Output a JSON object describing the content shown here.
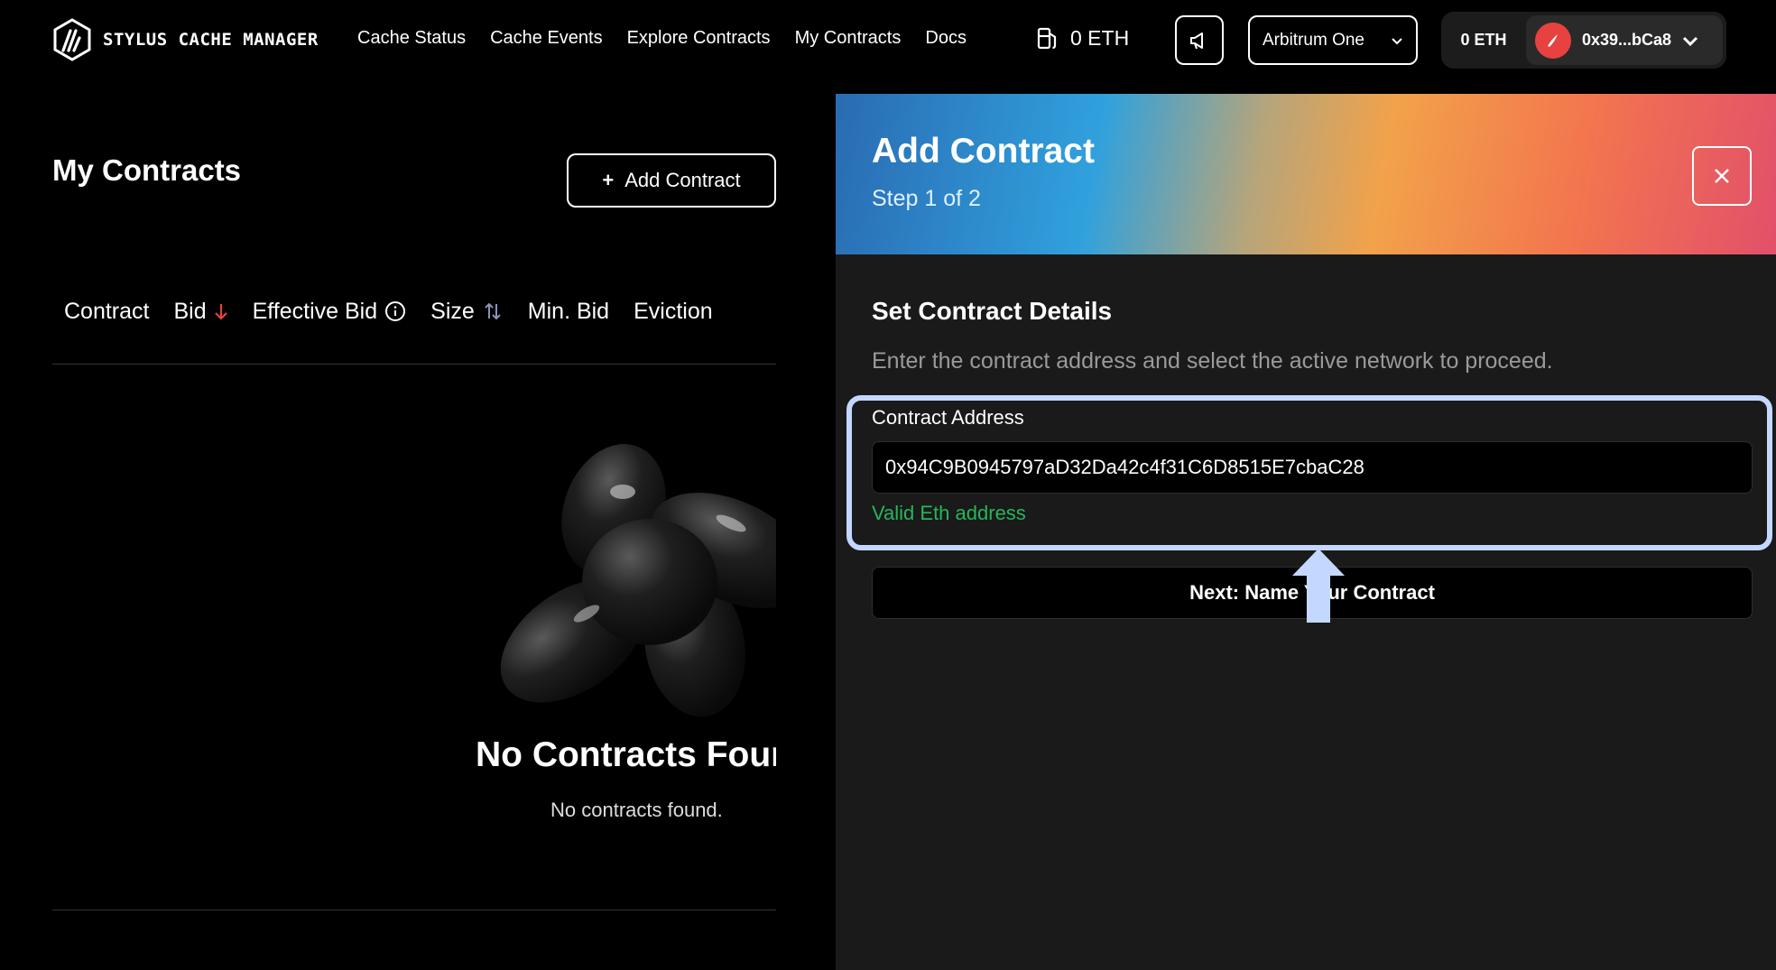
{
  "app": {
    "name": "STYLUS CACHE MANAGER"
  },
  "nav": {
    "items": [
      "Cache Status",
      "Cache Events",
      "Explore Contracts",
      "My Contracts",
      "Docs"
    ]
  },
  "header": {
    "gas_value": "0 ETH",
    "network": "Arbitrum One",
    "wallet_balance": "0 ETH",
    "wallet_address": "0x39...bCa8"
  },
  "page": {
    "title": "My Contracts",
    "add_button": "Add Contract",
    "columns": [
      "Contract",
      "Bid",
      "Effective Bid",
      "Size",
      "Min. Bid",
      "Eviction"
    ],
    "empty_title": "No Contracts Found",
    "empty_subtitle": "No contracts found."
  },
  "drawer": {
    "title": "Add Contract",
    "step": "Step 1 of 2",
    "section_title": "Set Contract Details",
    "section_desc": "Enter the contract address and select the active network to proceed.",
    "field_label": "Contract Address",
    "field_value": "0x94C9B0945797aD32Da42c4f31C6D8515E7cbaC28",
    "validation": "Valid Eth address",
    "next_button": "Next: Name Your Contract"
  },
  "colors": {
    "accent_red": "#e7423f",
    "valid_green": "#27b55b",
    "highlight": "#c4d8ff"
  },
  "icons": [
    "logo-icon",
    "gas-pump-icon",
    "megaphone-icon",
    "chevron-down-icon",
    "avatar-icon",
    "plus-icon",
    "arrow-down-icon",
    "info-icon",
    "sort-icon",
    "close-icon",
    "arrow-up-annotation"
  ]
}
